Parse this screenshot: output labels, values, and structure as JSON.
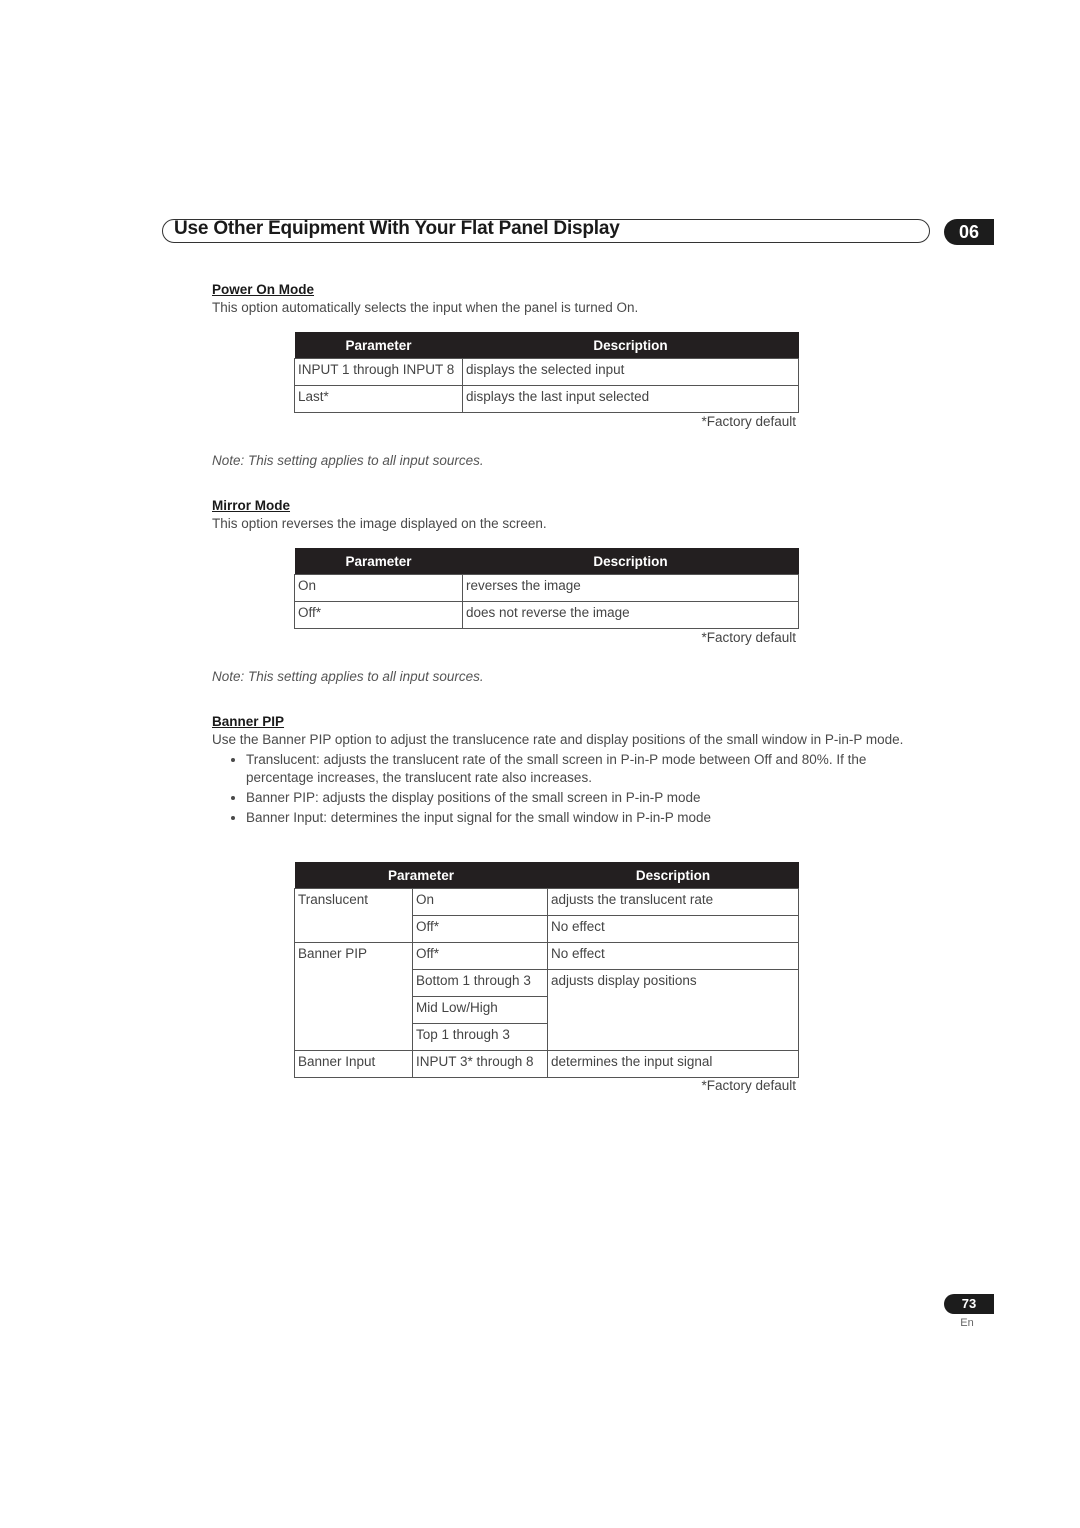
{
  "header": {
    "title": "Use Other Equipment With Your Flat Panel Display",
    "chapter": "06"
  },
  "power_on_mode": {
    "heading": "Power On Mode",
    "intro": "This option automatically selects the input when the panel is turned On.",
    "table": {
      "headers": [
        "Parameter",
        "Description"
      ],
      "rows": [
        [
          "INPUT 1 through INPUT 8",
          "displays the selected input"
        ],
        [
          "Last*",
          "displays the last input selected"
        ]
      ]
    },
    "footnote": "*Factory default",
    "note": "Note: This setting applies to all input sources."
  },
  "mirror_mode": {
    "heading": "Mirror Mode",
    "intro": "This option reverses the image displayed on the screen.",
    "table": {
      "headers": [
        "Parameter",
        "Description"
      ],
      "rows": [
        [
          "On",
          "reverses the image"
        ],
        [
          "Off*",
          "does not reverse the image"
        ]
      ]
    },
    "footnote": "*Factory default",
    "note": "Note: This setting applies to all input sources."
  },
  "banner_pip": {
    "heading": "Banner PIP",
    "intro": "Use the Banner PIP option to adjust the translucence rate and display positions of the small window in P-in-P mode.",
    "bullets": [
      "Translucent: adjusts the translucent rate of the small screen in P-in-P mode between Off and 80%. If the percentage increases, the translucent rate also increases.",
      "Banner PIP: adjusts the display positions of the small screen in P-in-P mode",
      "Banner Input: determines the input signal for the small window in P-in-P mode"
    ],
    "table": {
      "headers": [
        "Parameter",
        "Description"
      ],
      "groups": {
        "translucent": "Translucent",
        "banner_pip": "Banner PIP",
        "banner_input": "Banner Input"
      },
      "values": {
        "t_on": "On",
        "t_off": "Off*",
        "b_off": "Off*",
        "b_bottom": "Bottom 1 through 3",
        "b_mid": "Mid Low/High",
        "b_top": "Top 1 through 3",
        "i_input": "INPUT 3* through 8"
      },
      "descriptions": {
        "t_on": "adjusts the translucent rate",
        "t_off": "No effect",
        "b_off": "No effect",
        "b_positions": "adjusts display positions",
        "i_input": "determines the input signal"
      }
    },
    "footnote": "*Factory default"
  },
  "footer": {
    "page_number": "73",
    "language": "En"
  }
}
